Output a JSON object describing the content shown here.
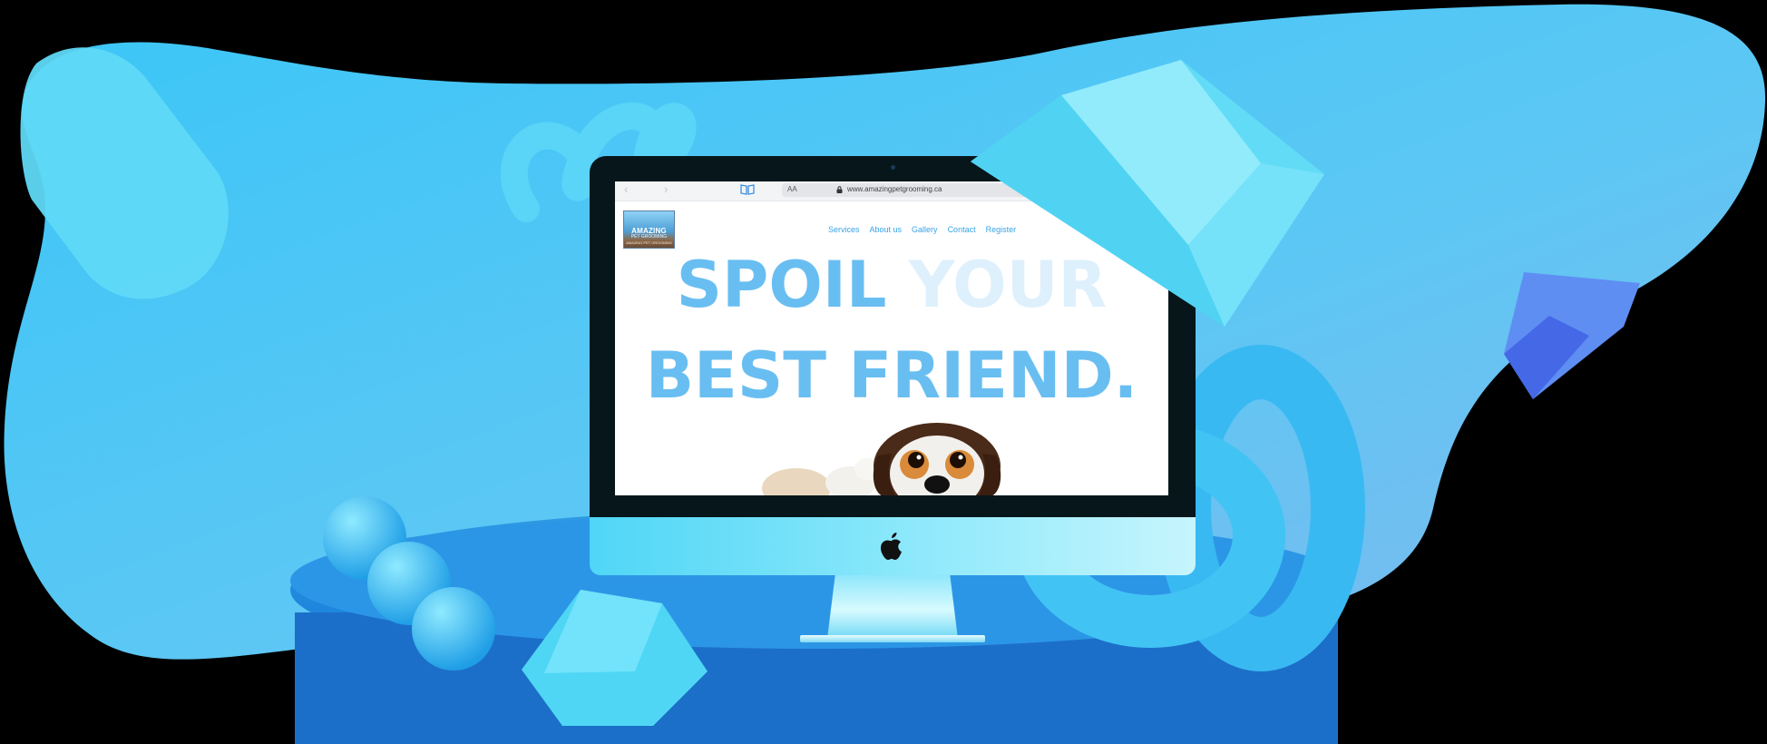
{
  "browser": {
    "address_text_size_label": "AA",
    "url": "www.amazingpetgrooming.ca"
  },
  "site": {
    "logo": {
      "line1": "AMAZING",
      "line2": "PET GROOMING",
      "line3": "AMAZING PET GROOMING"
    },
    "nav": [
      "Services",
      "About us",
      "Gallery",
      "Contact",
      "Register"
    ],
    "hero": {
      "line1_word1": "SPOIL",
      "line1_word2": "YOUR",
      "line2": "BEST FRIEND."
    }
  },
  "icons": {
    "book": "book-icon",
    "lock": "lock-icon",
    "apple": "apple-logo-icon"
  },
  "colors": {
    "accent": "#69bef1",
    "nav_link": "#36a4e6",
    "background_blob": "#3fc3f5"
  }
}
